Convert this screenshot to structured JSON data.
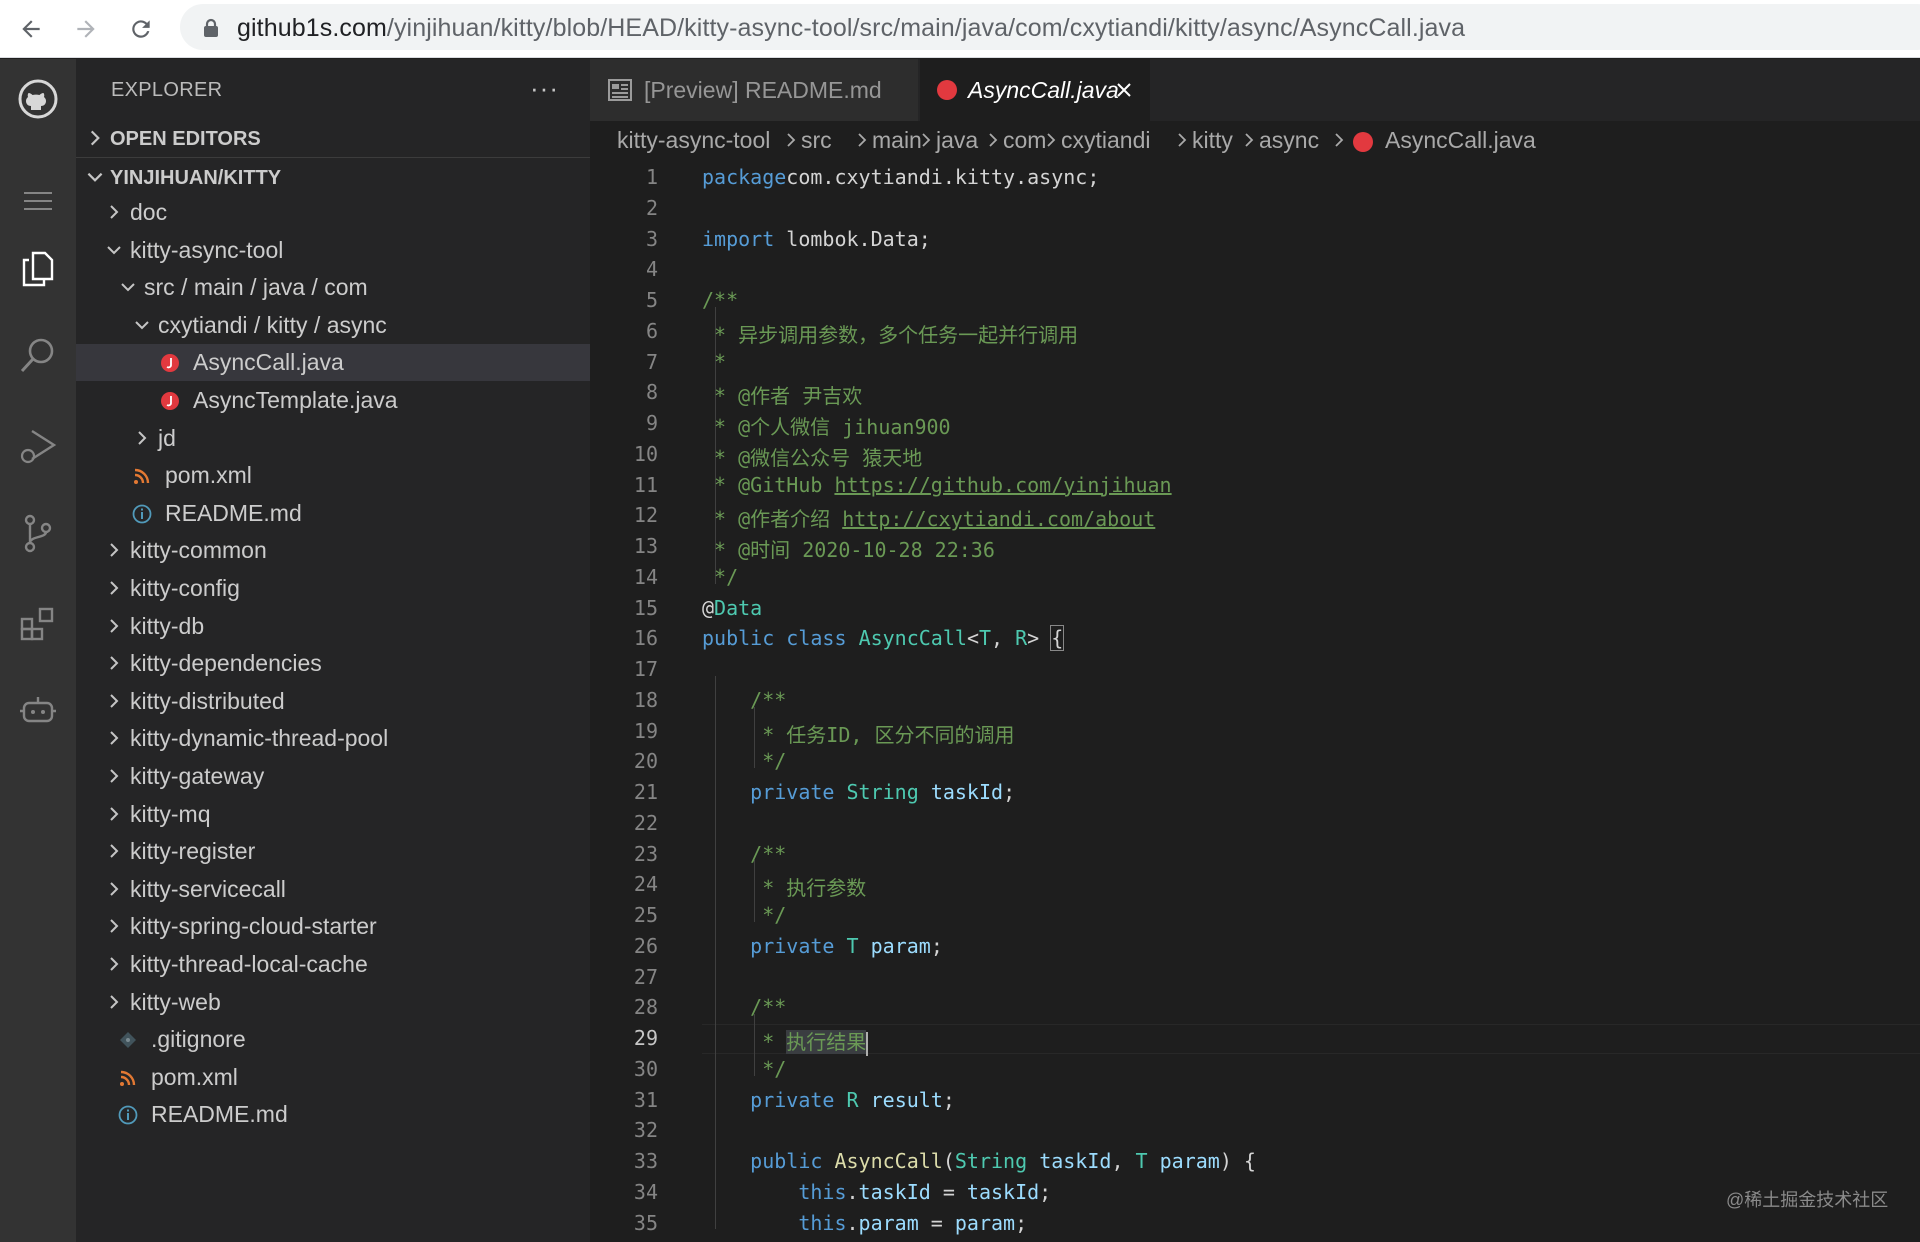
{
  "browser": {
    "url_host": "github1s.com",
    "url_path": "/yinjihuan/kitty/blob/HEAD/kitty-async-tool/src/main/java/com/cxytiandi/kitty/async/AsyncCall.java"
  },
  "activity_bar": {
    "icons": [
      "github-icon",
      "menu-icon",
      "explorer-icon",
      "search-icon",
      "run-debug-icon",
      "source-control-icon",
      "extensions-icon",
      "remote-icon"
    ]
  },
  "sidebar": {
    "title": "EXPLORER",
    "more": "···",
    "open_editors": "OPEN EDITORS",
    "repo": "YINJIHUAN/KITTY",
    "tree": [
      {
        "label": "doc",
        "type": "folder",
        "expanded": false
      },
      {
        "label": "kitty-async-tool",
        "type": "folder",
        "expanded": true
      },
      {
        "label": "src / main / java / com",
        "type": "folder",
        "expanded": true
      },
      {
        "label": "cxytiandi / kitty / async",
        "type": "folder",
        "expanded": true
      },
      {
        "label": "AsyncCall.java",
        "type": "java",
        "selected": true
      },
      {
        "label": "AsyncTemplate.java",
        "type": "java"
      },
      {
        "label": "jd",
        "type": "folder",
        "expanded": false
      },
      {
        "label": "pom.xml",
        "type": "xml"
      },
      {
        "label": "README.md",
        "type": "info"
      },
      {
        "label": "kitty-common",
        "type": "folder"
      },
      {
        "label": "kitty-config",
        "type": "folder"
      },
      {
        "label": "kitty-db",
        "type": "folder"
      },
      {
        "label": "kitty-dependencies",
        "type": "folder"
      },
      {
        "label": "kitty-distributed",
        "type": "folder"
      },
      {
        "label": "kitty-dynamic-thread-pool",
        "type": "folder"
      },
      {
        "label": "kitty-gateway",
        "type": "folder"
      },
      {
        "label": "kitty-mq",
        "type": "folder"
      },
      {
        "label": "kitty-register",
        "type": "folder"
      },
      {
        "label": "kitty-servicecall",
        "type": "folder"
      },
      {
        "label": "kitty-spring-cloud-starter",
        "type": "folder"
      },
      {
        "label": "kitty-thread-local-cache",
        "type": "folder"
      },
      {
        "label": "kitty-web",
        "type": "folder"
      },
      {
        "label": ".gitignore",
        "type": "git"
      },
      {
        "label": "pom.xml",
        "type": "xml"
      },
      {
        "label": "README.md",
        "type": "info"
      }
    ]
  },
  "tabs": [
    {
      "label": "[Preview] README.md",
      "active": false
    },
    {
      "label": "AsyncCall.java",
      "active": true
    }
  ],
  "breadcrumb": [
    "kitty-async-tool",
    "src",
    "main",
    "java",
    "com",
    "cxytiandi",
    "kitty",
    "async",
    "AsyncCall.java"
  ],
  "editor": {
    "current_line": 29,
    "lines": [
      [
        [
          "kw",
          "package"
        ],
        [
          "",
          "com.cxytiandi.kitty.async;"
        ]
      ],
      [],
      [
        [
          "kw",
          "import"
        ],
        [
          "",
          " lombok.Data;"
        ]
      ],
      [],
      [
        [
          "cm",
          "/**"
        ]
      ],
      [
        [
          "cm",
          " * 异步调用参数，多个任务一起并行调用"
        ]
      ],
      [
        [
          "cm",
          " *"
        ]
      ],
      [
        [
          "cm",
          " * @作者 尹吉欢"
        ]
      ],
      [
        [
          "cm",
          " * @个人微信 jihuan900"
        ]
      ],
      [
        [
          "cm",
          " * @微信公众号 猿天地"
        ]
      ],
      [
        [
          "cm",
          " * @GitHub "
        ],
        [
          "cmlink",
          "https://github.com/yinjihuan"
        ]
      ],
      [
        [
          "cm",
          " * @作者介绍 "
        ],
        [
          "cmlink",
          "http://cxytiandi.com/about"
        ]
      ],
      [
        [
          "cm",
          " * @时间 2020-10-28 22:36"
        ]
      ],
      [
        [
          "cm",
          " */"
        ]
      ],
      [
        [
          "",
          "@"
        ],
        [
          "an",
          "Data"
        ]
      ],
      [
        [
          "kw",
          "public"
        ],
        [
          "",
          " "
        ],
        [
          "kw",
          "class"
        ],
        [
          "",
          " "
        ],
        [
          "ty",
          "AsyncCall"
        ],
        [
          "",
          "<"
        ],
        [
          "tp",
          "T"
        ],
        [
          "",
          ", "
        ],
        [
          "tp",
          "R"
        ],
        [
          "",
          "> "
        ],
        [
          "brk",
          "{"
        ]
      ],
      [],
      [
        [
          "",
          "    "
        ],
        [
          "cm",
          "/**"
        ]
      ],
      [
        [
          "",
          "    "
        ],
        [
          "cm",
          " * 任务ID, 区分不同的调用"
        ]
      ],
      [
        [
          "",
          "    "
        ],
        [
          "cm",
          " */"
        ]
      ],
      [
        [
          "",
          "    "
        ],
        [
          "kw",
          "private"
        ],
        [
          "",
          " "
        ],
        [
          "ty",
          "String"
        ],
        [
          "",
          " "
        ],
        [
          "va",
          "taskId"
        ],
        [
          "",
          ";"
        ]
      ],
      [],
      [
        [
          "",
          "    "
        ],
        [
          "cm",
          "/**"
        ]
      ],
      [
        [
          "",
          "    "
        ],
        [
          "cm",
          " * 执行参数"
        ]
      ],
      [
        [
          "",
          "    "
        ],
        [
          "cm",
          " */"
        ]
      ],
      [
        [
          "",
          "    "
        ],
        [
          "kw",
          "private"
        ],
        [
          "",
          " "
        ],
        [
          "tp",
          "T"
        ],
        [
          "",
          " "
        ],
        [
          "va",
          "param"
        ],
        [
          "",
          ";"
        ]
      ],
      [],
      [
        [
          "",
          "    "
        ],
        [
          "cm",
          "/**"
        ]
      ],
      [
        [
          "",
          "    "
        ],
        [
          "cm",
          " * "
        ],
        [
          "hlcm",
          "执行结果"
        ],
        [
          "caret",
          ""
        ]
      ],
      [
        [
          "",
          "    "
        ],
        [
          "cm",
          " */"
        ]
      ],
      [
        [
          "",
          "    "
        ],
        [
          "kw",
          "private"
        ],
        [
          "",
          " "
        ],
        [
          "tp",
          "R"
        ],
        [
          "",
          " "
        ],
        [
          "va",
          "result"
        ],
        [
          "",
          ";"
        ]
      ],
      [],
      [
        [
          "",
          "    "
        ],
        [
          "kw",
          "public"
        ],
        [
          "",
          " "
        ],
        [
          "fn",
          "AsyncCall"
        ],
        [
          "",
          "("
        ],
        [
          "ty",
          "String"
        ],
        [
          "",
          " "
        ],
        [
          "va",
          "taskId"
        ],
        [
          "",
          ", "
        ],
        [
          "tp",
          "T"
        ],
        [
          "",
          " "
        ],
        [
          "va",
          "param"
        ],
        [
          "",
          ") {"
        ]
      ],
      [
        [
          "",
          "        "
        ],
        [
          "kw",
          "this"
        ],
        [
          "",
          "."
        ],
        [
          "va",
          "taskId"
        ],
        [
          "",
          " = "
        ],
        [
          "va",
          "taskId"
        ],
        [
          "",
          ";"
        ]
      ],
      [
        [
          "",
          "        "
        ],
        [
          "kw",
          "this"
        ],
        [
          "",
          "."
        ],
        [
          "va",
          "param"
        ],
        [
          "",
          " = "
        ],
        [
          "va",
          "param"
        ],
        [
          "",
          ";"
        ]
      ]
    ]
  },
  "watermark": "@稀土掘金技术社区",
  "colors": {
    "java_icon": "#e2393f",
    "xml_icon": "#e37933",
    "info_icon": "#519aba"
  }
}
